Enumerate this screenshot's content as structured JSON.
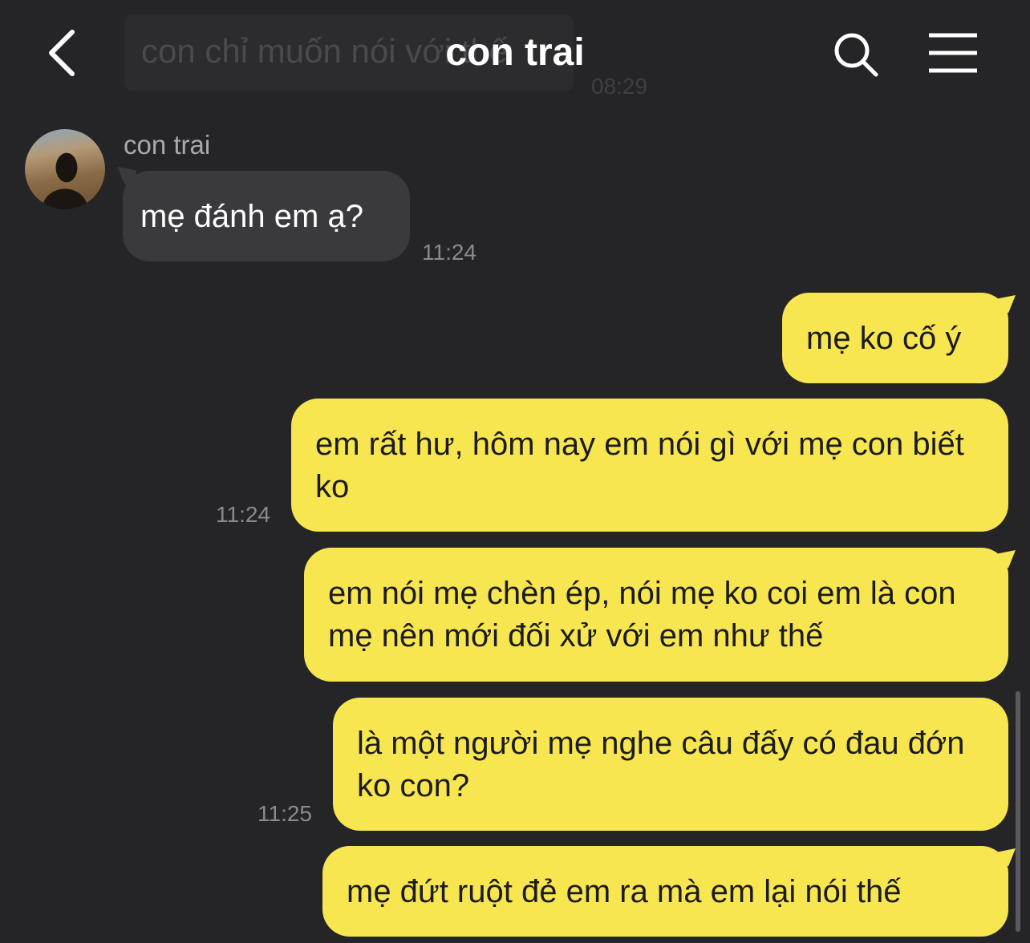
{
  "header": {
    "title": "con trai",
    "back_icon": "chevron-left-icon",
    "search_icon": "search-icon",
    "menu_icon": "hamburger-menu-icon"
  },
  "pinned_preview": {
    "text": "con chỉ muốn nói với thế",
    "time": "08:29"
  },
  "contact": {
    "name": "con trai"
  },
  "messages": [
    {
      "direction": "incoming",
      "text": "mẹ đánh em ạ?",
      "time": "11:24"
    },
    {
      "direction": "outgoing",
      "text": "mẹ ko cố ý",
      "time": ""
    },
    {
      "direction": "outgoing",
      "text": "em rất hư, hôm nay em nói gì với mẹ con biết ko",
      "time": "11:24"
    },
    {
      "direction": "outgoing",
      "text": "em nói mẹ chèn ép, nói mẹ ko coi em là con mẹ nên mới đối xử với em như thế",
      "time": ""
    },
    {
      "direction": "outgoing",
      "text": "là một người mẹ nghe câu đấy có đau đớn ko con?",
      "time": "11:25"
    },
    {
      "direction": "outgoing",
      "text": "mẹ đứt ruột đẻ em ra mà em lại nói thế",
      "time": ""
    }
  ],
  "colors": {
    "background": "#252528",
    "incoming_bubble": "#3a3a3d",
    "outgoing_bubble": "#f7e64f",
    "timestamp": "#8a8a8e"
  }
}
